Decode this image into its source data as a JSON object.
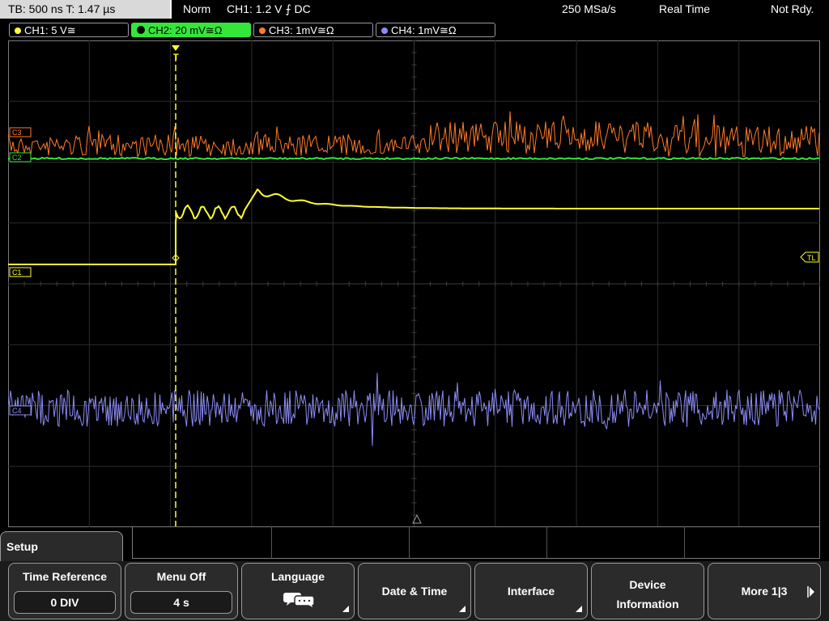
{
  "topbar": {
    "timebase": "TB: 500 ns   T: 1.47 µs",
    "trigger_mode": "Norm",
    "trigger_info": "CH1: 1.2 V ⨍ DC",
    "sample_rate": "250 MSa/s",
    "acq_mode": "Real Time",
    "status": "Not Rdy."
  },
  "channels": [
    {
      "label": "CH1: 5 V≅",
      "color": "#ffff30"
    },
    {
      "label": "CH2: 20 mV≅Ω",
      "color": "#35e63a"
    },
    {
      "label": "CH3: 1mV≅Ω",
      "color": "#ff7a2a"
    },
    {
      "label": "CH4: 1mV≅Ω",
      "color": "#8c8cf5"
    }
  ],
  "markers": {
    "trigger": "T",
    "trigger_level": "TL",
    "ch1": "C1",
    "ch2": "C2",
    "ch3": "C3",
    "ch4": "C4"
  },
  "menu": {
    "title": "Setup",
    "softkeys": [
      {
        "title": "Time Reference",
        "value": "0 DIV"
      },
      {
        "title": "Menu Off",
        "value": "4 s"
      },
      {
        "title": "Language"
      },
      {
        "title": "Date & Time"
      },
      {
        "title": "Interface"
      },
      {
        "title": "Device Information"
      },
      {
        "title": "More 1|3"
      }
    ]
  }
}
